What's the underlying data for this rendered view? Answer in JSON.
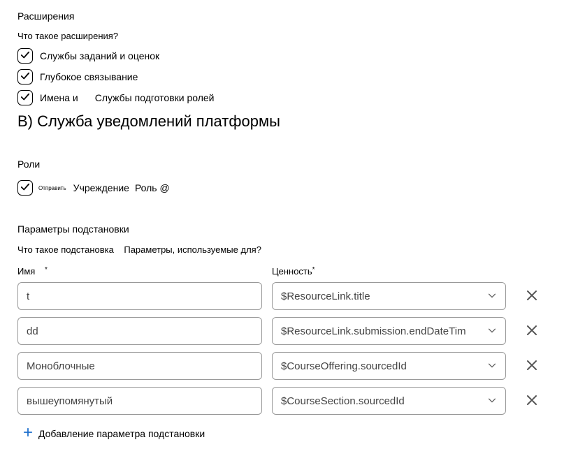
{
  "extensions": {
    "title": "Расширения",
    "question": "Что такое расширения?",
    "items": [
      {
        "label": "Службы заданий и оценок"
      },
      {
        "label": "Глубокое связывание"
      },
      {
        "label_part1": "Имена и",
        "label_part2": "Службы подготовки ролей"
      }
    ]
  },
  "heading_b": "B) Служба уведомлений платформы",
  "roles": {
    "title": "Роли",
    "small": "Отправить",
    "institution": "Учреждение",
    "role": "Роль @"
  },
  "substitution": {
    "title": "Параметры подстановки",
    "question_part1": "Что такое подстановка",
    "question_part2": "Параметры, используемые для?",
    "col_name": "Имя",
    "col_value": "Ценность",
    "asterisk": "*",
    "asterisk2": "*",
    "rows": [
      {
        "name": "t",
        "value": "$ResourceLink.title"
      },
      {
        "name": "dd",
        "value": "$ResourceLink.submission.endDateTim"
      },
      {
        "name": "Моноблочные",
        "value": "$CourseOffering.sourcedId"
      },
      {
        "name": "вышеупомянутый",
        "value": "$CourseSection.sourcedId"
      }
    ],
    "add_label": "Добавление параметра подстановки"
  }
}
